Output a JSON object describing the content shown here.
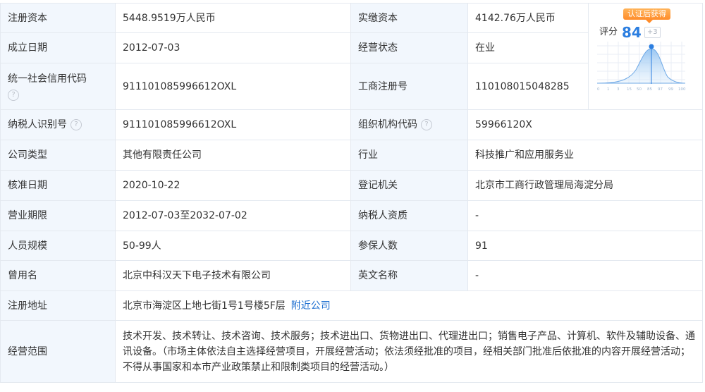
{
  "rows": [
    {
      "k1": "注册资本",
      "v1": "5448.9519万人民币",
      "k2": "实缴资本",
      "v2": "4142.76万人民币"
    },
    {
      "k1": "成立日期",
      "v1": "2012-07-03",
      "k2": "经营状态",
      "v2": "在业"
    },
    {
      "k1": "统一社会信用代码",
      "v1": "911101085996612OXL",
      "k2": "工商注册号",
      "v2": "110108015048285"
    },
    {
      "k1": "纳税人识别号",
      "v1": "911101085996612OXL",
      "k2": "组织机构代码",
      "v2": "59966120X"
    },
    {
      "k1": "公司类型",
      "v1": "其他有限责任公司",
      "k2": "行业",
      "v2": "科技推广和应用服务业"
    },
    {
      "k1": "核准日期",
      "v1": "2020-10-22",
      "k2": "登记机关",
      "v2": "北京市工商行政管理局海淀分局"
    },
    {
      "k1": "营业期限",
      "v1": "2012-07-03至2032-07-02",
      "k2": "纳税人资质",
      "v2": "-"
    },
    {
      "k1": "人员规模",
      "v1": "50-99人",
      "k2": "参保人数",
      "v2": "91"
    },
    {
      "k1": "曾用名",
      "v1": "北京中科汉天下电子技术有限公司",
      "k2": "英文名称",
      "v2": "-"
    },
    {
      "k1": "注册地址",
      "v1": "北京市海淀区上地七街1号1号楼5F层",
      "link": "附近公司"
    },
    {
      "k1": "经营范围",
      "v1": "技术开发、技术转让、技术咨询、技术服务；技术进出口、货物进出口、代理进出口；销售电子产品、计算机、软件及辅助设备、通讯设备。（市场主体依法自主选择经营项目，开展经营活动；依法须经批准的项目，经相关部门批准后依批准的内容开展经营活动；不得从事国家和本市产业政策禁止和限制类项目的经营活动。）"
    }
  ],
  "help_icon": "?",
  "score": {
    "badge": "认证后获得",
    "label": "评分",
    "value": "84",
    "delta": "+3",
    "axis_ticks": [
      "0",
      "1",
      "3",
      "15",
      "50",
      "85",
      "97",
      "99",
      "100"
    ]
  },
  "colors": {
    "key_bg": "#f2f7fd",
    "border": "#e4e9f0",
    "accent": "#2b7ee0",
    "badge": "#ff8c2a"
  }
}
